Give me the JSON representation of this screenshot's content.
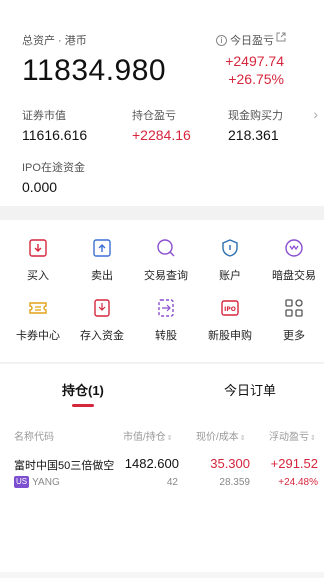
{
  "account": {
    "total_label": "总资产 · 港币",
    "today_pnl_label": "今日盈亏",
    "total_value": "11834.980",
    "today_pnl_amount": "+2497.74",
    "today_pnl_percent": "+26.75%",
    "market_value_label": "证券市值",
    "market_value": "11616.616",
    "position_pnl_label": "持仓盈亏",
    "position_pnl": "+2284.16",
    "cash_power_label": "现金购买力",
    "cash_power": "218.361",
    "ipo_label": "IPO在途资金",
    "ipo_value": "0.000"
  },
  "functions": [
    {
      "label": "买入",
      "icon": "buy-icon"
    },
    {
      "label": "卖出",
      "icon": "sell-icon"
    },
    {
      "label": "交易查询",
      "icon": "trade-query-icon"
    },
    {
      "label": "账户",
      "icon": "account-shield-icon"
    },
    {
      "label": "暗盘交易",
      "icon": "dark-pool-icon"
    },
    {
      "label": "卡券中心",
      "icon": "coupon-icon"
    },
    {
      "label": "存入资金",
      "icon": "deposit-icon"
    },
    {
      "label": "转股",
      "icon": "transfer-icon"
    },
    {
      "label": "新股申购",
      "icon": "ipo-icon"
    },
    {
      "label": "更多",
      "icon": "more-grid-icon"
    }
  ],
  "tabs": {
    "positions": "持仓(1)",
    "today_orders": "今日订单"
  },
  "table": {
    "headers": {
      "name": "名称代码",
      "value_qty": "市值/持仓",
      "price_cost": "现价/成本",
      "floating_pnl": "浮动盈亏"
    },
    "rows": [
      {
        "name": "富时中国50三倍做空",
        "market": "US",
        "code": "YANG",
        "market_value": "1482.600",
        "quantity": "42",
        "price": "35.300",
        "cost": "28.359",
        "pnl": "+291.52",
        "pnl_percent": "+24.48%"
      }
    ]
  },
  "colors": {
    "up_red": "#d6263d",
    "accent": "#d6263d"
  }
}
